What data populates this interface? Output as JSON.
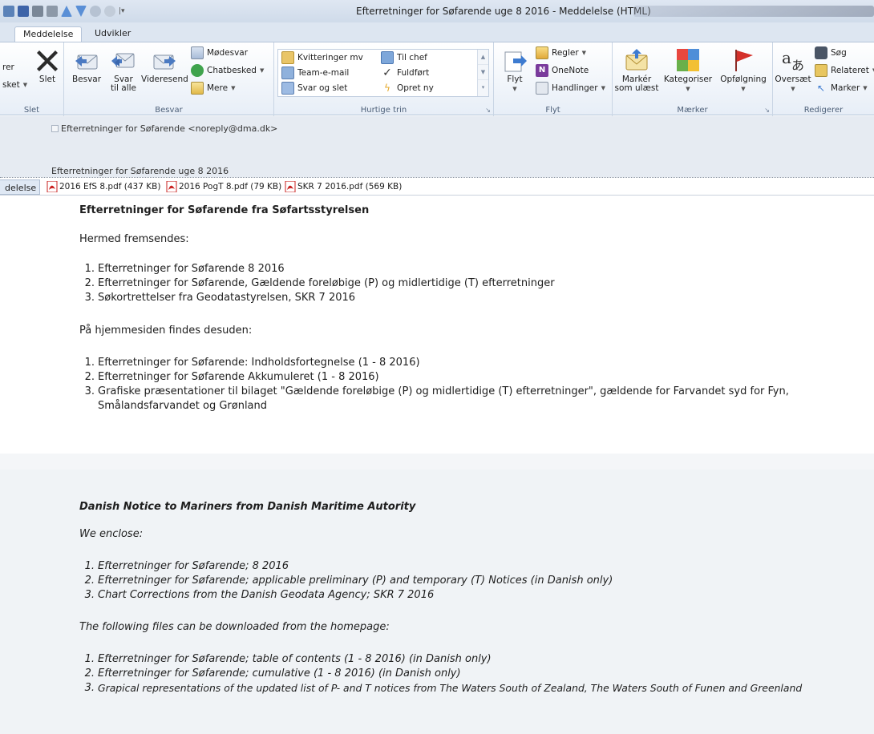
{
  "window": {
    "title": "Efterretninger for Søfarende uge 8 2016  -  Meddelelse (HTML)"
  },
  "ribbon": {
    "tabs": [
      {
        "label": "Meddelelse",
        "active": true
      },
      {
        "label": "Udvikler",
        "active": false
      }
    ],
    "groups": {
      "slet": {
        "label": "Slet",
        "partial_top": "rer",
        "partial_junk": "sket",
        "slet_button": "Slet"
      },
      "besvar": {
        "label": "Besvar",
        "besvar": "Besvar",
        "svar_til_alle_1": "Svar",
        "svar_til_alle_2": "til alle",
        "videresend": "Videresend",
        "modesvar": "Mødesvar",
        "chatbesked": "Chatbesked",
        "mere": "Mere"
      },
      "hurtige_trin": {
        "label": "Hurtige trin",
        "items": [
          "Kvitteringer mv",
          "Team-e-mail",
          "Svar og slet",
          "Til chef",
          "Fuldført",
          "Opret ny"
        ]
      },
      "flyt": {
        "label": "Flyt",
        "flyt_button": "Flyt",
        "regler": "Regler",
        "onenote": "OneNote",
        "handlinger": "Handlinger"
      },
      "maerker": {
        "label": "Mærker",
        "marker_ulaest_1": "Markér",
        "marker_ulaest_2": "som ulæst",
        "kategoriser": "Kategoriser",
        "opfolgning": "Opfølgning"
      },
      "redigerer": {
        "label": "Redigerer",
        "oversaet": "Oversæt",
        "sog": "Søg",
        "relateret": "Relateret",
        "marker": "Marker"
      }
    }
  },
  "message": {
    "from": "Efterretninger for Søfarende <noreply@dma.dk>",
    "subject": "Efterretninger for Søfarende uge 8 2016",
    "message_tab": "delelse",
    "attachments": [
      {
        "name": "2016 EfS 8.pdf (437 KB)"
      },
      {
        "name": "2016 PogT 8.pdf (79 KB)"
      },
      {
        "name": "SKR 7 2016.pdf (569 KB)"
      }
    ]
  },
  "body": {
    "danish": {
      "heading": "Efterretninger for Søfarende fra Søfartsstyrelsen",
      "intro1": "Hermed fremsendes:",
      "list1": [
        "Efterretninger for Søfarende 8 2016",
        "Efterretninger for Søfarende, Gældende foreløbige (P) og midlertidige (T) efterretninger",
        "Søkortrettelser fra Geodatastyrelsen, SKR 7 2016"
      ],
      "intro2": "På hjemmesiden findes desuden:",
      "list2": [
        "Efterretninger for Søfarende: Indholdsfortegnelse (1 - 8 2016)",
        "Efterretninger for Søfarende Akkumuleret (1 - 8 2016)",
        "Grafiske præsentationer til bilaget \"Gældende foreløbige (P) og midlertidige (T) efterretninger\", gældende for Farvandet syd for Fyn,"
      ],
      "list2_item3_cont": "Smålandsfarvandet og Grønland"
    },
    "english": {
      "heading": "Danish Notice to Mariners from Danish Maritime Autority",
      "intro1": "We enclose:",
      "list1": [
        "Efterretninger for Søfarende; 8 2016",
        "Efterretninger for Søfarende; applicable preliminary (P) and temporary (T) Notices (in Danish only)",
        "Chart Corrections from the Danish Geodata Agency; SKR 7 2016"
      ],
      "intro2": "The following files can be downloaded from the homepage:",
      "list2": [
        "Efterretninger for Søfarende; table of contents (1 - 8 2016) (in Danish only)",
        "Efterretninger for Søfarende; cumulative (1 - 8 2016) (in Danish only)",
        "Grapical representations of the updated list of P- and T notices from The Waters South of Zealand, The Waters South of Funen and Greenland"
      ],
      "numbers": [
        "1.",
        "2.",
        "3."
      ]
    }
  },
  "icons": {
    "delete": "x-icon",
    "reply": "reply-icon",
    "reply_all": "reply-all-icon",
    "forward": "forward-icon",
    "move": "folder-move-icon",
    "unread": "envelope-icon",
    "categorize": "color-grid-icon",
    "followup": "red-flag-icon",
    "translate": "translate-icon",
    "attachment": "pdf-icon"
  },
  "colors": {
    "ribbon_bg": "#e7eef7",
    "header_bg": "#e6ebf2",
    "english_bg": "#f0f3f6",
    "flag_red": "#d4302a",
    "pdf_red": "#c9201f"
  }
}
